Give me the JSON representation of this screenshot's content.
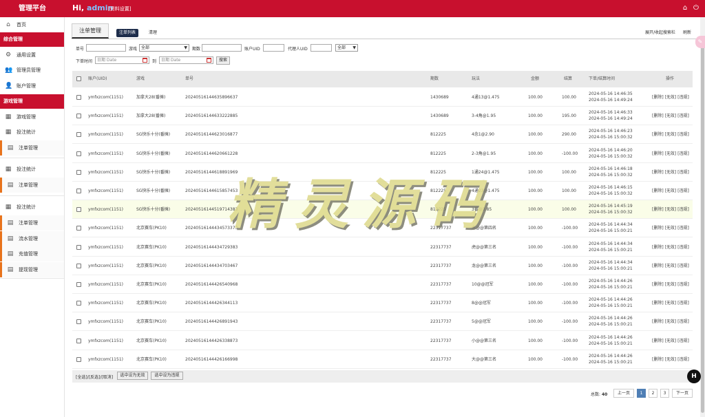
{
  "header": {
    "brand": "管理平台",
    "greeting": "Hi,",
    "username": "admin",
    "profile_link": "[资料设置]",
    "home_icon": "home-icon",
    "power_icon": "power-icon"
  },
  "sidebar": {
    "home": "首页",
    "group1": "综合管理",
    "general_settings": "通用设置",
    "admin_mgmt": "管理员管理",
    "account_mgmt": "账户管理",
    "group2": "游戏管理",
    "game_mgmt": "游戏管理",
    "bet_stats": "投注统计",
    "order_mgmt": "注单管理",
    "bet_stats2": "投注统计",
    "order_mgmt2": "注单管理",
    "bet_stats3": "投注统计",
    "order_mgmt3": "注单管理",
    "flow_mgmt": "流水管理",
    "recharge_mgmt": "充值管理",
    "withdraw_mgmt": "提现管理"
  },
  "page": {
    "tab": "注单管理",
    "subtab_list": "注单列表",
    "subtab_clear": "清理",
    "toggle_search": "展开/收起搜索栏",
    "refresh": "刷新"
  },
  "filter": {
    "order_no_label": "单号",
    "game_label": "游戏",
    "game_value": "全部",
    "period_label": "期数",
    "account_uid_label": "账户UID",
    "agent_uid_label": "代理人UID",
    "agent_select": "全部",
    "time_label": "下单时间",
    "date_placeholder1": "日期 Date",
    "to_label": "到",
    "date_placeholder2": "日期 Date",
    "search_button": "搜索"
  },
  "table": {
    "columns": [
      "账户(UID)",
      "游戏",
      "单号",
      "期数",
      "玩法",
      "金额",
      "结算",
      "下单/结算时间",
      "操作"
    ],
    "rows": [
      {
        "account": "ymfxzcom(1151)",
        "game": "加拿大28(番摊)",
        "order": "20240516144635896637",
        "period": "1430689",
        "play": "4通13@1.475",
        "amount": "100.00",
        "settle": "100.00",
        "t1": "2024-05-16 14:46:35",
        "t2": "2024-05-16 14:49:24",
        "ops": "[删除] [无效] [违规]"
      },
      {
        "account": "ymfxzcom(1151)",
        "game": "加拿大28(番摊)",
        "order": "20240516144633222885",
        "period": "1430689",
        "play": "3-4角@1.95",
        "amount": "100.00",
        "settle": "195.00",
        "t1": "2024-05-16 14:46:33",
        "t2": "2024-05-16 14:49:24",
        "ops": "[删除] [无效] [违规]"
      },
      {
        "account": "ymfxzcom(1151)",
        "game": "SG快乐十分(番摊)",
        "order": "20240516144623016877",
        "period": "812225",
        "play": "4念1@2.90",
        "amount": "100.00",
        "settle": "290.00",
        "t1": "2024-05-16 14:46:23",
        "t2": "2024-05-16 15:00:32",
        "ops": "[删除] [无效] [违规]"
      },
      {
        "account": "ymfxzcom(1151)",
        "game": "SG快乐十分(番摊)",
        "order": "20240516144620661228",
        "period": "812225",
        "play": "2-3角@1.95",
        "amount": "100.00",
        "settle": "-100.00",
        "t1": "2024-05-16 14:46:20",
        "t2": "2024-05-16 15:00:32",
        "ops": "[删除] [无效] [违规]"
      },
      {
        "account": "ymfxzcom(1151)",
        "game": "SG快乐十分(番摊)",
        "order": "20240516144618891969",
        "period": "812225",
        "play": "1通24@1.475",
        "amount": "100.00",
        "settle": "100.00",
        "t1": "2024-05-16 14:46:18",
        "t2": "2024-05-16 15:00:32",
        "ops": "[删除] [无效] [违规]"
      },
      {
        "account": "ymfxzcom(1151)",
        "game": "SG快乐十分(番摊)",
        "order": "20240516144615857453",
        "period": "812225",
        "play": "4通23@1.475",
        "amount": "100.00",
        "settle": "100.00",
        "t1": "2024-05-16 14:46:15",
        "t2": "2024-05-16 15:00:32",
        "ops": "[删除] [无效] [违规]"
      },
      {
        "account": "ymfxzcom(1151)",
        "game": "SG快乐十分(番摊)",
        "order": "20240516144519714383",
        "period": "812225",
        "play": "3番@3.85",
        "amount": "100.00",
        "settle": "100.00",
        "t1": "2024-05-16 14:45:19",
        "t2": "2024-05-16 15:00:32",
        "ops": "[删除] [无效] [违规]"
      },
      {
        "account": "ymfxzcom(1151)",
        "game": "北京赛车(PK10)",
        "order": "20240516144434573373",
        "period": "22317737",
        "play": "龙@@第四名",
        "amount": "100.00",
        "settle": "-100.00",
        "t1": "2024-05-16 14:44:34",
        "t2": "2024-05-16 15:00:21",
        "ops": "[删除] [无效] [违规]"
      },
      {
        "account": "ymfxzcom(1151)",
        "game": "北京赛车(PK10)",
        "order": "20240516144434729383",
        "period": "22317737",
        "play": "虎@@第三名",
        "amount": "100.00",
        "settle": "-100.00",
        "t1": "2024-05-16 14:44:34",
        "t2": "2024-05-16 15:00:21",
        "ops": "[删除] [无效] [违规]"
      },
      {
        "account": "ymfxzcom(1151)",
        "game": "北京赛车(PK10)",
        "order": "20240516144434703467",
        "period": "22317737",
        "play": "龙@@第三名",
        "amount": "100.00",
        "settle": "-100.00",
        "t1": "2024-05-16 14:44:34",
        "t2": "2024-05-16 15:00:21",
        "ops": "[删除] [无效] [违规]"
      },
      {
        "account": "ymfxzcom(1151)",
        "game": "北京赛车(PK10)",
        "order": "20240516144426540968",
        "period": "22317737",
        "play": "10@@冠军",
        "amount": "100.00",
        "settle": "-100.00",
        "t1": "2024-05-16 14:44:26",
        "t2": "2024-05-16 15:00:21",
        "ops": "[删除] [无效] [违规]"
      },
      {
        "account": "ymfxzcom(1151)",
        "game": "北京赛车(PK10)",
        "order": "20240516144426344113",
        "period": "22317737",
        "play": "8@@冠军",
        "amount": "100.00",
        "settle": "-100.00",
        "t1": "2024-05-16 14:44:26",
        "t2": "2024-05-16 15:00:21",
        "ops": "[删除] [无效] [违规]"
      },
      {
        "account": "ymfxzcom(1151)",
        "game": "北京赛车(PK10)",
        "order": "20240516144426891943",
        "period": "22317737",
        "play": "5@@冠军",
        "amount": "100.00",
        "settle": "-100.00",
        "t1": "2024-05-16 14:44:26",
        "t2": "2024-05-16 15:00:21",
        "ops": "[删除] [无效] [违规]"
      },
      {
        "account": "ymfxzcom(1151)",
        "game": "北京赛车(PK10)",
        "order": "20240516144426338873",
        "period": "22317737",
        "play": "小@@第三名",
        "amount": "100.00",
        "settle": "-100.00",
        "t1": "2024-05-16 14:44:26",
        "t2": "2024-05-16 15:00:21",
        "ops": "[删除] [无效] [违规]"
      },
      {
        "account": "ymfxzcom(1151)",
        "game": "北京赛车(PK10)",
        "order": "20240516144426166998",
        "period": "22317737",
        "play": "大@@第三名",
        "amount": "100.00",
        "settle": "-100.00",
        "t1": "2024-05-16 14:44:26",
        "t2": "2024-05-16 15:00:21",
        "ops": "[删除] [无效] [违规]"
      }
    ]
  },
  "footer": {
    "select_links": "[全选]/[反选]/[取消]",
    "set_invalid": "选中设为无效",
    "set_violation": "选中设为违规"
  },
  "pagination": {
    "total_label": "总数:",
    "total": "40",
    "prev": "上一页",
    "pages": [
      "1",
      "2",
      "3"
    ],
    "next": "下一页"
  },
  "watermark": "精灵源码",
  "fab_label": "H"
}
